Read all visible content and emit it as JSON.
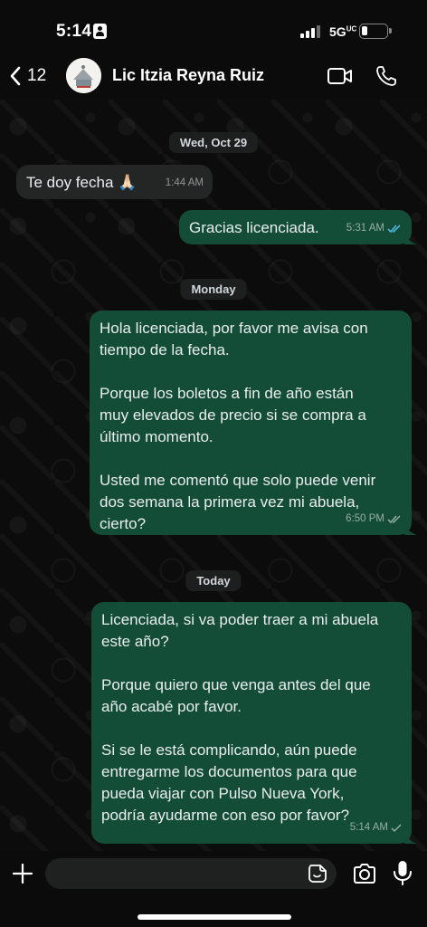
{
  "status_bar": {
    "time": "5:14",
    "network": "5G",
    "network_suffix": "UC",
    "battery_level": 0.25
  },
  "header": {
    "back_count": "12",
    "contact_name": "Lic Itzia Reyna Ruiz",
    "icons": [
      "chevron-left-icon",
      "video-call-icon",
      "phone-icon"
    ]
  },
  "messages": [
    {
      "type": "date",
      "text": "Wed, Oct 29"
    },
    {
      "type": "in",
      "text": "Te doy fecha 🙏🏻",
      "time": "1:44 AM"
    },
    {
      "type": "out",
      "text": "Gracias licenciada.",
      "time": "5:31 AM",
      "status": "read"
    },
    {
      "type": "date",
      "text": "Monday"
    },
    {
      "type": "out",
      "text": "Hola licenciada, por favor me avisa con\ntiempo de la fecha.\n\nPorque los boletos a fin de año están\nmuy elevados de precio si se compra a\núltimo momento.\n\nUsted me comentó que solo puede venir\ndos semana la primera vez mi abuela,\ncierto?",
      "time": "6:50 PM",
      "status": "delivered"
    },
    {
      "type": "date",
      "text": "Today"
    },
    {
      "type": "out",
      "text": "Licenciada, si va poder traer a mi abuela\neste año?\n\nPorque quiero que venga antes del que\naño acabé por favor.\n\nSi se le está complicando, aún puede\nentregarme los documentos para que\npueda viajar con Pulso Nueva York,\npodría ayudarme con eso por favor?",
      "time": "5:14 AM",
      "status": "sent"
    }
  ],
  "composer": {
    "icons": [
      "plus-icon",
      "sticker-icon",
      "camera-icon",
      "microphone-icon"
    ]
  }
}
